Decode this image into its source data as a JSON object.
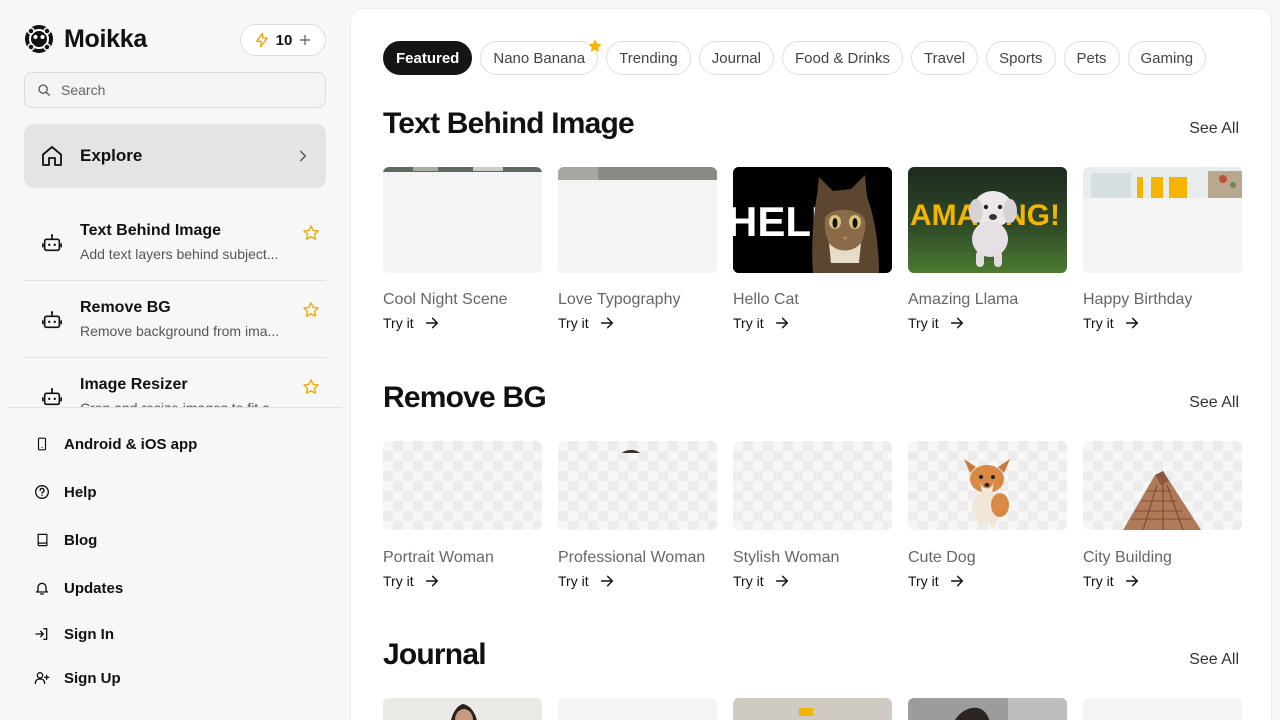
{
  "brand": {
    "name": "Moikka"
  },
  "credits": {
    "count": "10"
  },
  "search": {
    "placeholder": "Search"
  },
  "nav": {
    "explore": "Explore"
  },
  "tools": [
    {
      "title": "Text Behind Image",
      "desc": "Add text layers behind subject..."
    },
    {
      "title": "Remove BG",
      "desc": "Remove background from ima..."
    },
    {
      "title": "Image Resizer",
      "desc": "Crop and resize images to fit a..."
    }
  ],
  "links": {
    "app": "Android & iOS app",
    "help": "Help",
    "blog": "Blog",
    "updates": "Updates",
    "signin": "Sign In",
    "signup": "Sign Up"
  },
  "chips": [
    "Featured",
    "Nano Banana",
    "Trending",
    "Journal",
    "Food & Drinks",
    "Travel",
    "Sports",
    "Pets",
    "Gaming"
  ],
  "sections": [
    {
      "title": "Text Behind Image",
      "see_all": "See All",
      "cards": [
        {
          "title": "Cool Night Scene",
          "cta": "Try it"
        },
        {
          "title": "Love Typography",
          "cta": "Try it"
        },
        {
          "title": "Hello Cat",
          "cta": "Try it",
          "overlay": "HELLO"
        },
        {
          "title": "Amazing Llama",
          "cta": "Try it",
          "overlay": "AMAZING!"
        },
        {
          "title": "Happy Birthday",
          "cta": "Try it"
        }
      ]
    },
    {
      "title": "Remove BG",
      "see_all": "See All",
      "cards": [
        {
          "title": "Portrait Woman",
          "cta": "Try it"
        },
        {
          "title": "Professional Woman",
          "cta": "Try it"
        },
        {
          "title": "Stylish Woman",
          "cta": "Try it"
        },
        {
          "title": "Cute Dog",
          "cta": "Try it"
        },
        {
          "title": "City Building",
          "cta": "Try it"
        }
      ]
    },
    {
      "title": "Journal",
      "see_all": "See All"
    }
  ],
  "colors": {
    "accent": "#f5b400",
    "active_chip": "#151515"
  }
}
